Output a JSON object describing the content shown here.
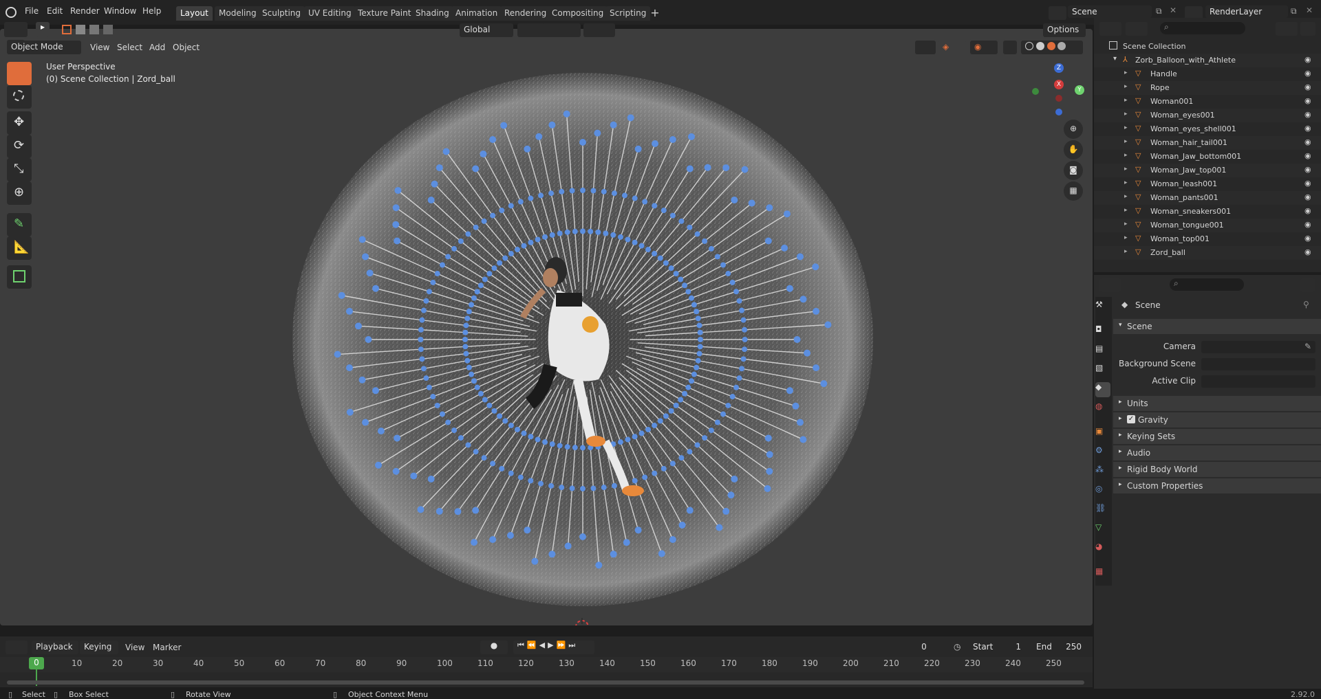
{
  "menu": [
    "File",
    "Edit",
    "Render",
    "Window",
    "Help"
  ],
  "workspaces": [
    "Layout",
    "Modeling",
    "Sculpting",
    "UV Editing",
    "Texture Paint",
    "Shading",
    "Animation",
    "Rendering",
    "Compositing",
    "Scripting"
  ],
  "active_workspace": "Layout",
  "scene_name": "Scene",
  "view_layer": "RenderLayer",
  "viewport": {
    "mode": "Object Mode",
    "menus": [
      "View",
      "Select",
      "Add",
      "Object"
    ],
    "transform_orientation": "Global",
    "options_label": "Options",
    "overlay_title": "User Perspective",
    "overlay_subtitle": "(0) Scene Collection | Zord_ball",
    "gizmo_axes": [
      "Z",
      "X",
      "Y"
    ]
  },
  "outliner": {
    "root": "Scene Collection",
    "collection": "Zorb_Balloon_with_Athlete",
    "items": [
      "Handle",
      "Rope",
      "Woman001",
      "Woman_eyes001",
      "Woman_eyes_shell001",
      "Woman_hair_tail001",
      "Woman_Jaw_bottom001",
      "Woman_Jaw_top001",
      "Woman_leash001",
      "Woman_pants001",
      "Woman_sneakers001",
      "Woman_tongue001",
      "Woman_top001",
      "Zord_ball"
    ]
  },
  "properties": {
    "context": "Scene",
    "panel": "Scene",
    "fields": [
      "Camera",
      "Background Scene",
      "Active Clip"
    ],
    "subpanels": [
      "Units",
      "Gravity",
      "Keying Sets",
      "Audio",
      "Rigid Body World",
      "Custom Properties"
    ],
    "gravity_checked": true
  },
  "timeline": {
    "menus": [
      "Playback",
      "Keying",
      "View",
      "Marker"
    ],
    "current_frame": "0",
    "start_label": "Start",
    "start": "1",
    "end_label": "End",
    "end": "250",
    "ticks": [
      "0",
      "10",
      "20",
      "30",
      "40",
      "50",
      "60",
      "70",
      "80",
      "90",
      "100",
      "110",
      "120",
      "130",
      "140",
      "150",
      "160",
      "170",
      "180",
      "190",
      "200",
      "210",
      "220",
      "230",
      "240",
      "250"
    ]
  },
  "status": {
    "select": "Select",
    "box_select": "Box Select",
    "rotate": "Rotate View",
    "context_menu": "Object Context Menu",
    "version": "2.92.0"
  },
  "colors": {
    "accent": "#e06d3b",
    "selection_blue": "#4772b3",
    "object_orange": "#e8893a",
    "modifier_blue": "#6f9cd9",
    "mesh_green": "#6fd36f"
  }
}
